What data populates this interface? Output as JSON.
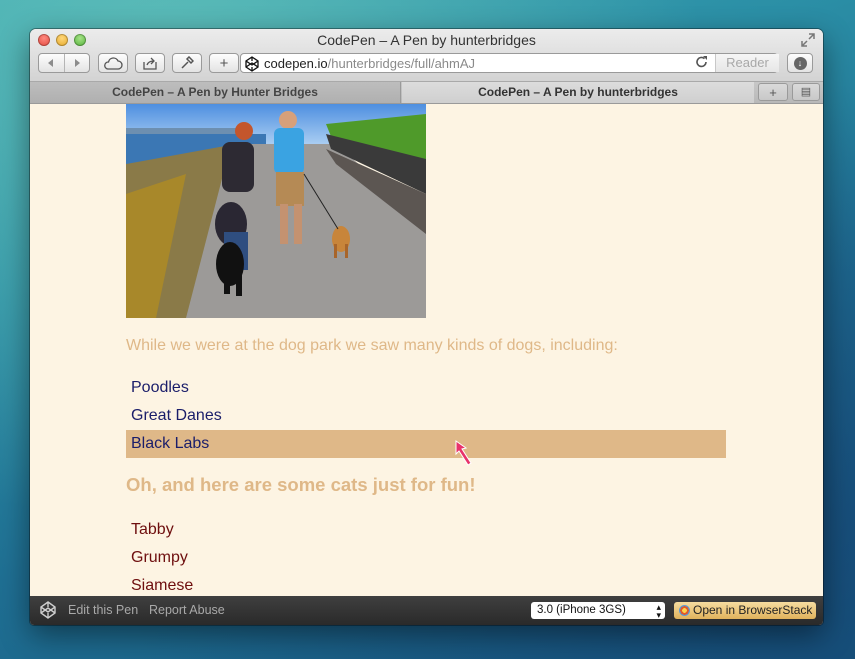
{
  "window": {
    "title": "CodePen – A Pen by hunterbridges"
  },
  "toolbar": {
    "back_icon": "back-arrow-icon",
    "forward_icon": "forward-arrow-icon",
    "url_host": "codepen.io",
    "url_path": "/hunterbridges/full/ahmAJ",
    "reader_label": "Reader"
  },
  "tabs": [
    {
      "label": "CodePen – A Pen by Hunter Bridges"
    },
    {
      "label": "CodePen – A Pen by hunterbridges"
    }
  ],
  "page": {
    "intro_text": "While we were at the dog park we saw many kinds of dogs, including:",
    "dogs": [
      "Poodles",
      "Great Danes",
      "Black Labs"
    ],
    "cats_heading": "Oh, and here are some cats just for fun!",
    "cats": [
      "Tabby",
      "Grumpy",
      "Siamese"
    ],
    "highlight_color": "#dfb888",
    "dog_text_color": "#1a1d6a",
    "cat_text_color": "#6e0e0e"
  },
  "bottombar": {
    "edit_label": "Edit this Pen",
    "report_label": "Report Abuse",
    "device_selected": "3.0 (iPhone 3GS)",
    "browserstack_label": "Open in BrowserStack"
  }
}
